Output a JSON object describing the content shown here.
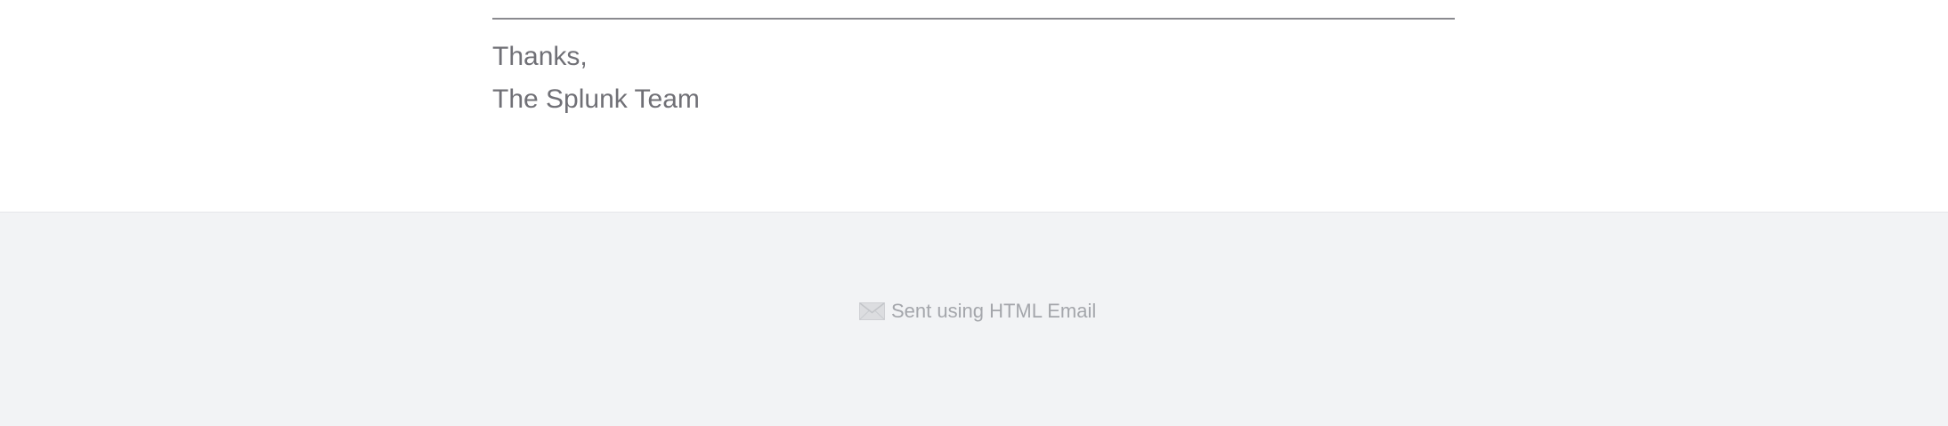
{
  "signoff": {
    "thanks": "Thanks,",
    "team": "The Splunk Team"
  },
  "footer": {
    "icon": "envelope-icon",
    "text": "Sent using HTML Email"
  },
  "colors": {
    "body_background": "#ffffff",
    "footer_background": "#f2f3f5",
    "signoff_text": "#707076",
    "footer_text": "#a4a6ab",
    "divider": "#8a8a8f"
  }
}
